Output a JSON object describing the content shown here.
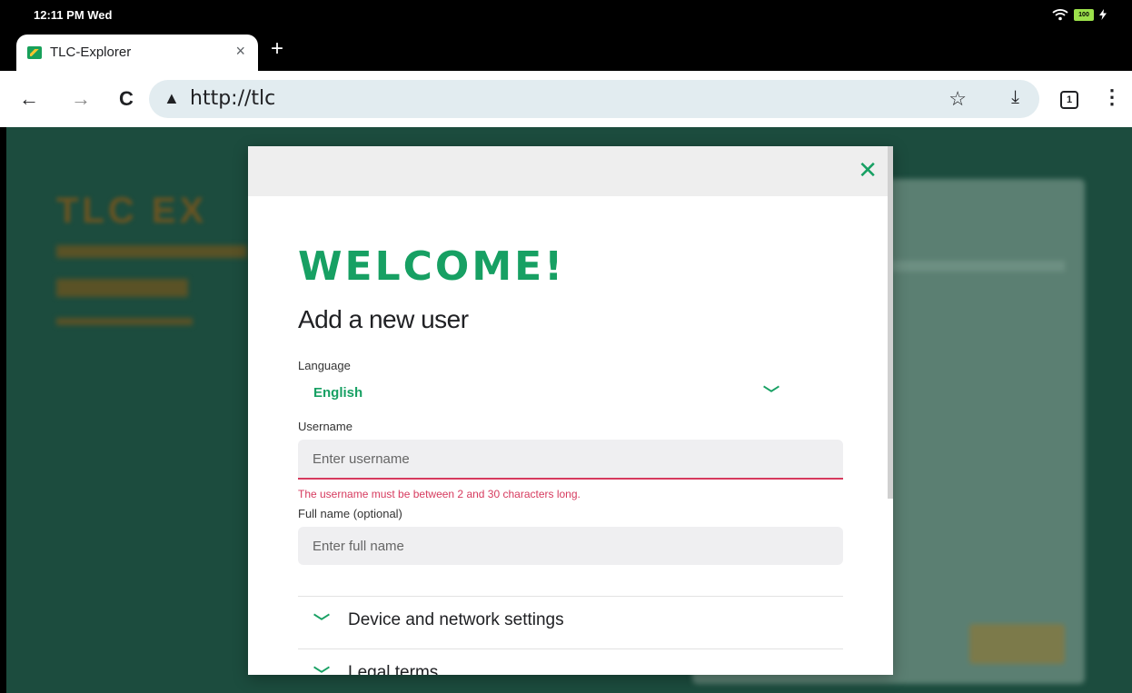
{
  "status_bar": {
    "time": "12:11 PM Wed",
    "battery": "100"
  },
  "browser": {
    "tab_title": "TLC-Explorer",
    "tab_close": "×",
    "new_tab": "+",
    "url": "http://tlc",
    "tab_count": "1"
  },
  "background": {
    "title": "TLC EX"
  },
  "modal": {
    "close": "✕",
    "welcome": "WELCOME!",
    "heading": "Add a new user",
    "language_label": "Language",
    "language_value": "English",
    "username_label": "Username",
    "username_placeholder": "Enter username",
    "username_value": "",
    "username_error": "The username must be between 2 and 30 characters long.",
    "fullname_label": "Full name (optional)",
    "fullname_placeholder": "Enter full name",
    "fullname_value": "",
    "sections": [
      {
        "label": "Device and network settings"
      },
      {
        "label": "Legal terms"
      }
    ]
  },
  "colors": {
    "accent": "#17a063",
    "error": "#d63a5e",
    "page_bg": "#1c4c3e"
  }
}
